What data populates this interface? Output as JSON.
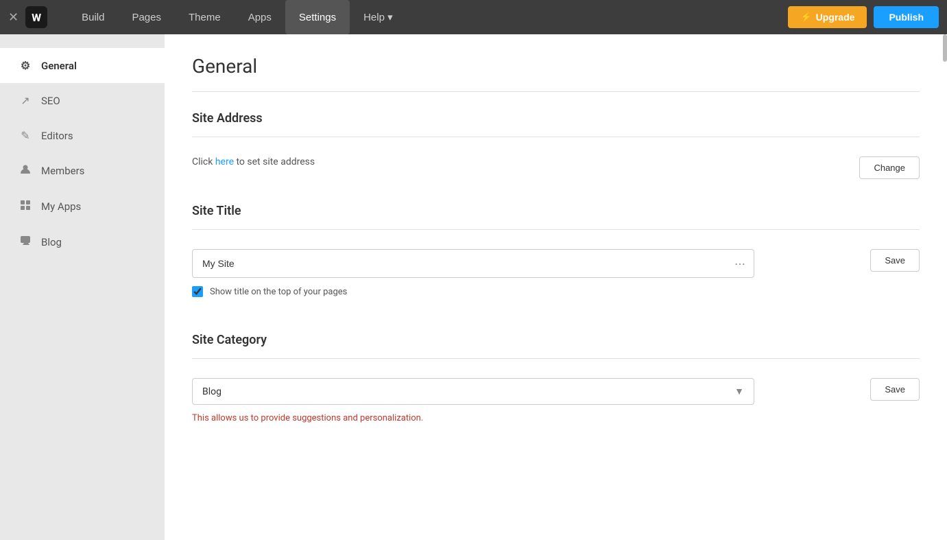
{
  "topnav": {
    "logo_letter": "W",
    "links": [
      {
        "id": "build",
        "label": "Build",
        "active": false
      },
      {
        "id": "pages",
        "label": "Pages",
        "active": false
      },
      {
        "id": "theme",
        "label": "Theme",
        "active": false
      },
      {
        "id": "apps",
        "label": "Apps",
        "active": false
      },
      {
        "id": "settings",
        "label": "Settings",
        "active": true
      },
      {
        "id": "help",
        "label": "Help ▾",
        "active": false
      }
    ],
    "upgrade_label": "Upgrade",
    "publish_label": "Publish"
  },
  "sidebar": {
    "items": [
      {
        "id": "general",
        "label": "General",
        "icon": "⚙",
        "active": true
      },
      {
        "id": "seo",
        "label": "SEO",
        "icon": "↗",
        "active": false
      },
      {
        "id": "editors",
        "label": "Editors",
        "icon": "✎",
        "active": false
      },
      {
        "id": "members",
        "label": "Members",
        "icon": "👤",
        "active": false
      },
      {
        "id": "my-apps",
        "label": "My Apps",
        "icon": "⊞",
        "active": false
      },
      {
        "id": "blog",
        "label": "Blog",
        "icon": "💬",
        "active": false
      }
    ]
  },
  "content": {
    "page_title": "General",
    "sections": {
      "site_address": {
        "title": "Site Address",
        "text_before": "Click ",
        "link_text": "here",
        "text_after": " to set site address",
        "change_button": "Change"
      },
      "site_title": {
        "title": "Site Title",
        "input_value": "My Site",
        "checkbox_label": "Show title on the top of your pages",
        "save_button": "Save"
      },
      "site_category": {
        "title": "Site Category",
        "selected": "Blog",
        "save_button": "Save",
        "hint": "This allows us to provide suggestions and personalization."
      }
    }
  }
}
